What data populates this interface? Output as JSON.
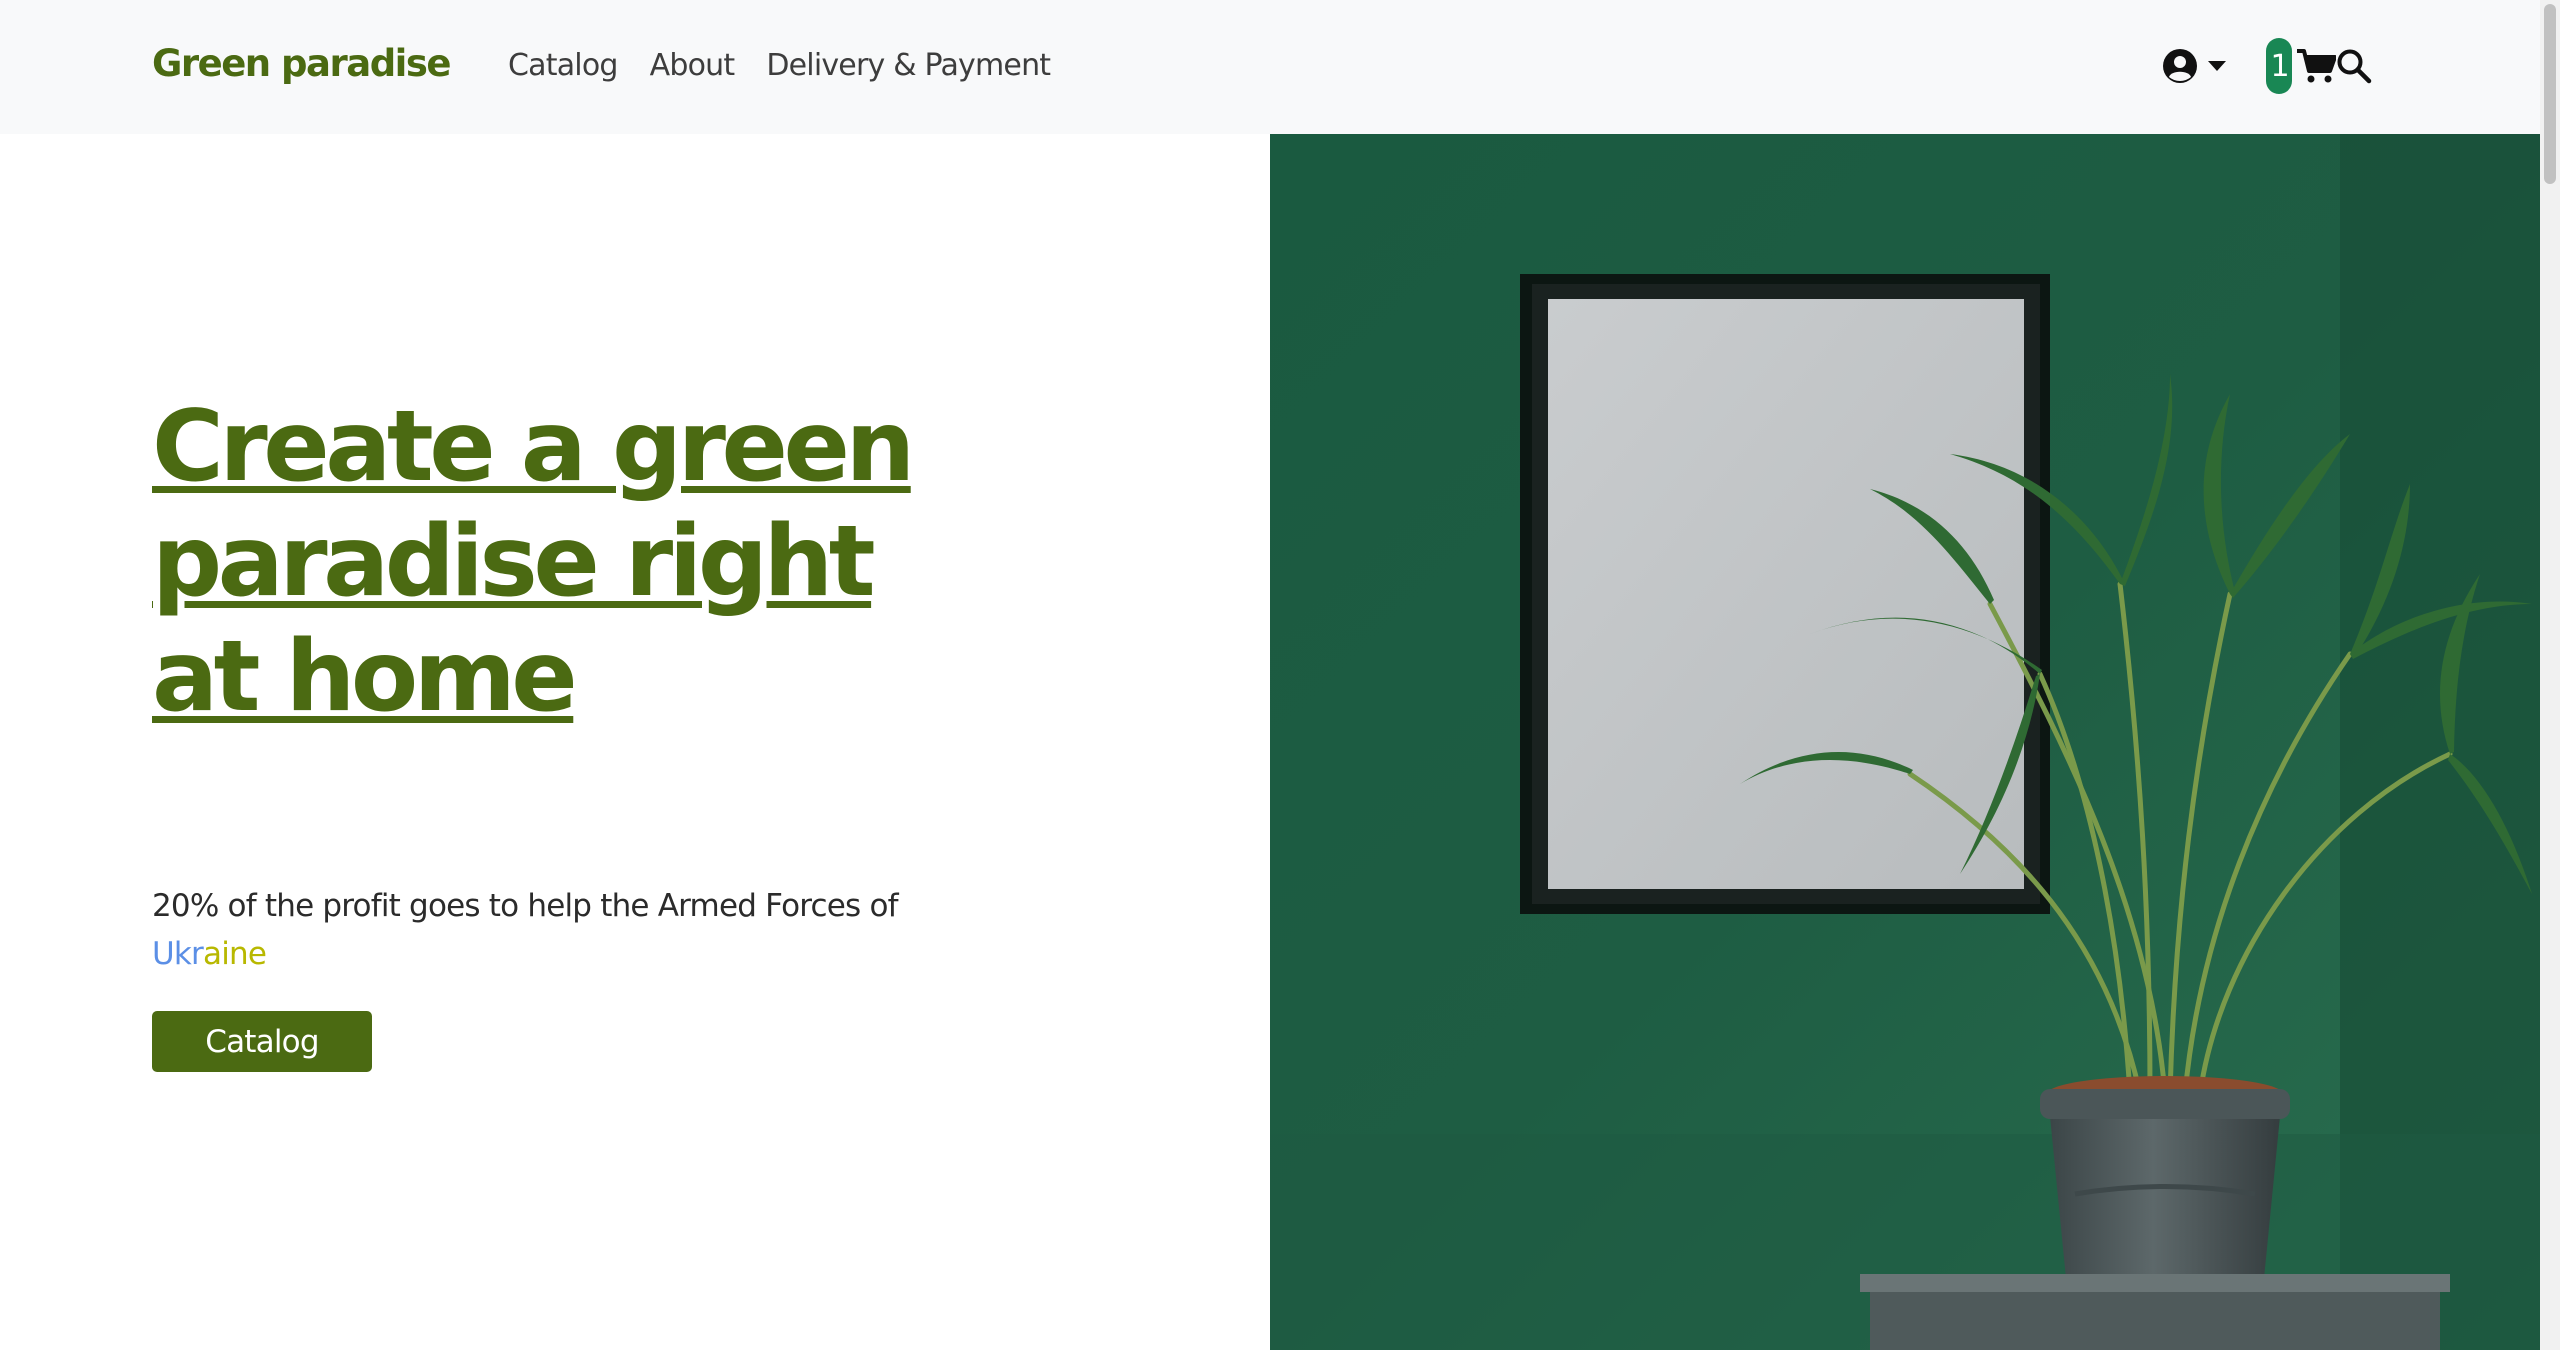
{
  "navbar": {
    "brand": "Green paradise",
    "links": [
      "Catalog",
      "About",
      "Delivery & Payment"
    ],
    "cart_count": "1"
  },
  "hero": {
    "title": "Create a green paradise right at home",
    "subtitle": "20% of the profit goes to help the Armed Forces of",
    "country_part1": "Ukr",
    "country_part2": "aine",
    "cta_label": "Catalog"
  },
  "colors": {
    "brand_green": "#4b6a12",
    "badge_green": "#198754",
    "wall_green": "#1e5c42",
    "navbar_bg": "#f8f9fa",
    "ukraine_blue": "#5b8fe6",
    "ukraine_yellow": "#b8b800"
  },
  "icons": [
    "user-circle-icon",
    "caret-down-icon",
    "shopping-cart-icon",
    "search-icon"
  ],
  "image": {
    "subject": "potted palm plant beside an empty picture frame on a dark green wall"
  }
}
